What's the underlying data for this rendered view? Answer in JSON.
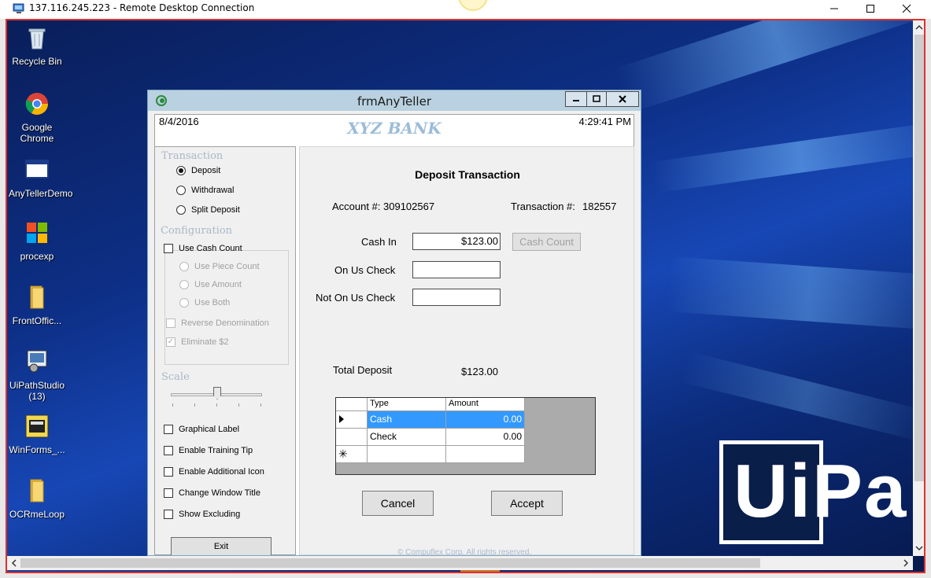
{
  "rdp": {
    "title": "137.116.245.223 - Remote Desktop Connection",
    "minimize": "—",
    "maximize": "☐",
    "close": "✕"
  },
  "desktop": {
    "icons": [
      {
        "label": "Recycle Bin",
        "icon": "recycle-bin-icon"
      },
      {
        "label": "Google Chrome",
        "icon": "chrome-icon"
      },
      {
        "label": "AnyTellerDemo",
        "icon": "app-window-icon"
      },
      {
        "label": "procexp",
        "icon": "procexp-icon"
      },
      {
        "label": "FrontOffic...",
        "icon": "folder-icon"
      },
      {
        "label": "UiPathStudio (13)",
        "icon": "uipath-studio-icon"
      },
      {
        "label": "WinForms_...",
        "icon": "cash-register-icon"
      },
      {
        "label": "OCRmeLoop",
        "icon": "folder-icon"
      }
    ],
    "logo_text": "UiPa"
  },
  "app": {
    "title": "frmAnyTeller",
    "date": "8/4/2016",
    "time": "4:29:41 PM",
    "bank_name": "XYZ BANK",
    "left": {
      "transaction_label": "Transaction",
      "transaction_options": [
        "Deposit",
        "Withdrawal",
        "Split Deposit"
      ],
      "selected_transaction": "Deposit",
      "configuration_label": "Configuration",
      "use_cash_count": "Use Cash Count",
      "count_options": [
        "Use Piece Count",
        "Use Amount",
        "Use Both"
      ],
      "reverse_denomination": "Reverse Denomination",
      "eliminate": "Eliminate $2",
      "scale_label": "Scale",
      "options": [
        "Graphical Label",
        "Enable Training Tip",
        "Enable Additional Icon",
        "Change Window Title",
        "Show Excluding"
      ],
      "exit": "Exit"
    },
    "right": {
      "heading": "Deposit Transaction",
      "account_label": "Account #:",
      "account_number": "309102567",
      "transaction_label": "Transaction #:",
      "transaction_number": "182557",
      "cash_in_label": "Cash In",
      "cash_in_value": "$123.00",
      "cash_count_button": "Cash Count",
      "on_us_label": "On Us Check",
      "on_us_value": "",
      "not_on_us_label": "Not On Us Check",
      "not_on_us_value": "",
      "total_label": "Total Deposit",
      "total_value": "$123.00",
      "grid": {
        "columns": [
          "Type",
          "Amount"
        ],
        "rows": [
          {
            "type": "Cash",
            "amount": "0.00"
          },
          {
            "type": "Check",
            "amount": "0.00"
          }
        ]
      },
      "cancel": "Cancel",
      "accept": "Accept",
      "footer": "© Compuflex Corp. All rights reserved."
    }
  }
}
